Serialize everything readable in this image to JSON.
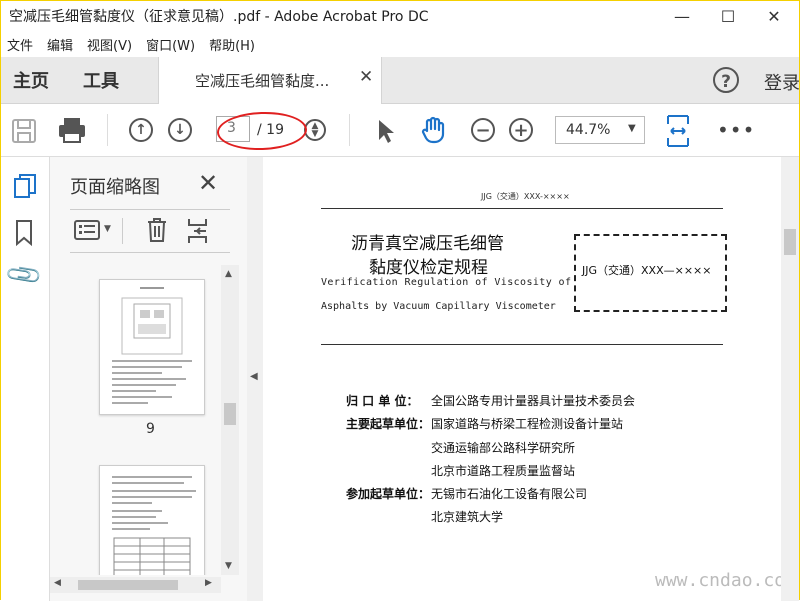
{
  "window": {
    "title": "空减压毛细管黏度仪（征求意见稿）.pdf - Adobe Acrobat Pro DC",
    "minimize": "—",
    "maximize": "☐",
    "close": "✕"
  },
  "menu": [
    "文件",
    "编辑",
    "视图(V)",
    "窗口(W)",
    "帮助(H)"
  ],
  "tabs": {
    "home": "主页",
    "tools": "工具",
    "document": "空减压毛细管黏度...",
    "help": "?",
    "login": "登录"
  },
  "toolbar": {
    "page_current": "3",
    "page_total": "/ 19",
    "zoom": "44.7%"
  },
  "panel": {
    "title": "页面缩略图",
    "thumb1_label": "9"
  },
  "document": {
    "header": "JJG（交通）XXX-××××",
    "title_line1": "沥青真空减压毛细管",
    "title_line2": "黏度仪检定规程",
    "en_line1": "Verification Regulation of Viscosity of",
    "en_line2": "Asphalts by Vacuum Capillary Viscometer",
    "code_box": "JJG（交通）XXX—××××",
    "rows": [
      {
        "label": "归 口 单 位：",
        "value": "全国公路专用计量器具计量技术委员会"
      },
      {
        "label": "主要起草单位：",
        "value": "国家道路与桥梁工程检测设备计量站"
      },
      {
        "label": "",
        "value": "交通运输部公路科学研究所"
      },
      {
        "label": "",
        "value": "北京市道路工程质量监督站"
      },
      {
        "label": "参加起草单位：",
        "value": "无锡市石油化工设备有限公司"
      },
      {
        "label": "",
        "value": "北京建筑大学"
      }
    ]
  },
  "watermark": "www.cndao.com",
  "colors": {
    "accent_blue": "#1d73c9",
    "annotation_red": "#e02020"
  }
}
